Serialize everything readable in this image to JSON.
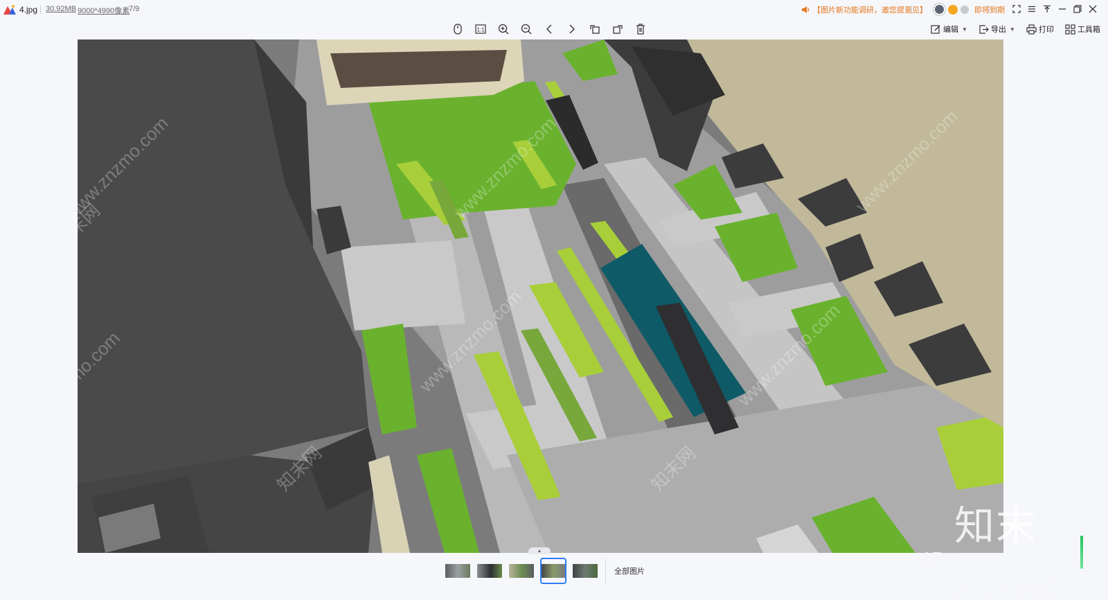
{
  "window": {
    "file_name": "4.jpg",
    "file_size": "30.92MB",
    "dimensions": "9000*4990像素",
    "position": "7/9",
    "notice": "【图片新功能调研，邀您提意见】",
    "expire_label": "即将到期"
  },
  "right_tools": {
    "edit": "编辑",
    "export": "导出",
    "print": "打印",
    "toolbox": "工具箱"
  },
  "image": {
    "brand_mark": "知末",
    "id_mark": "ID: 1132043801",
    "watermark_text": "www.znzmo.com",
    "watermark_cn": "知末网"
  },
  "thumbnails": {
    "all_label": "全部图片",
    "items": [
      "t1",
      "t2",
      "t3",
      "t4",
      "t5"
    ],
    "active_index": 4
  },
  "colors": {
    "accent": "#2f7bf5",
    "notice": "#e4761a",
    "lawn": "#6ab22e",
    "hedge": "#a8cf39",
    "water": "#0e5a66"
  }
}
